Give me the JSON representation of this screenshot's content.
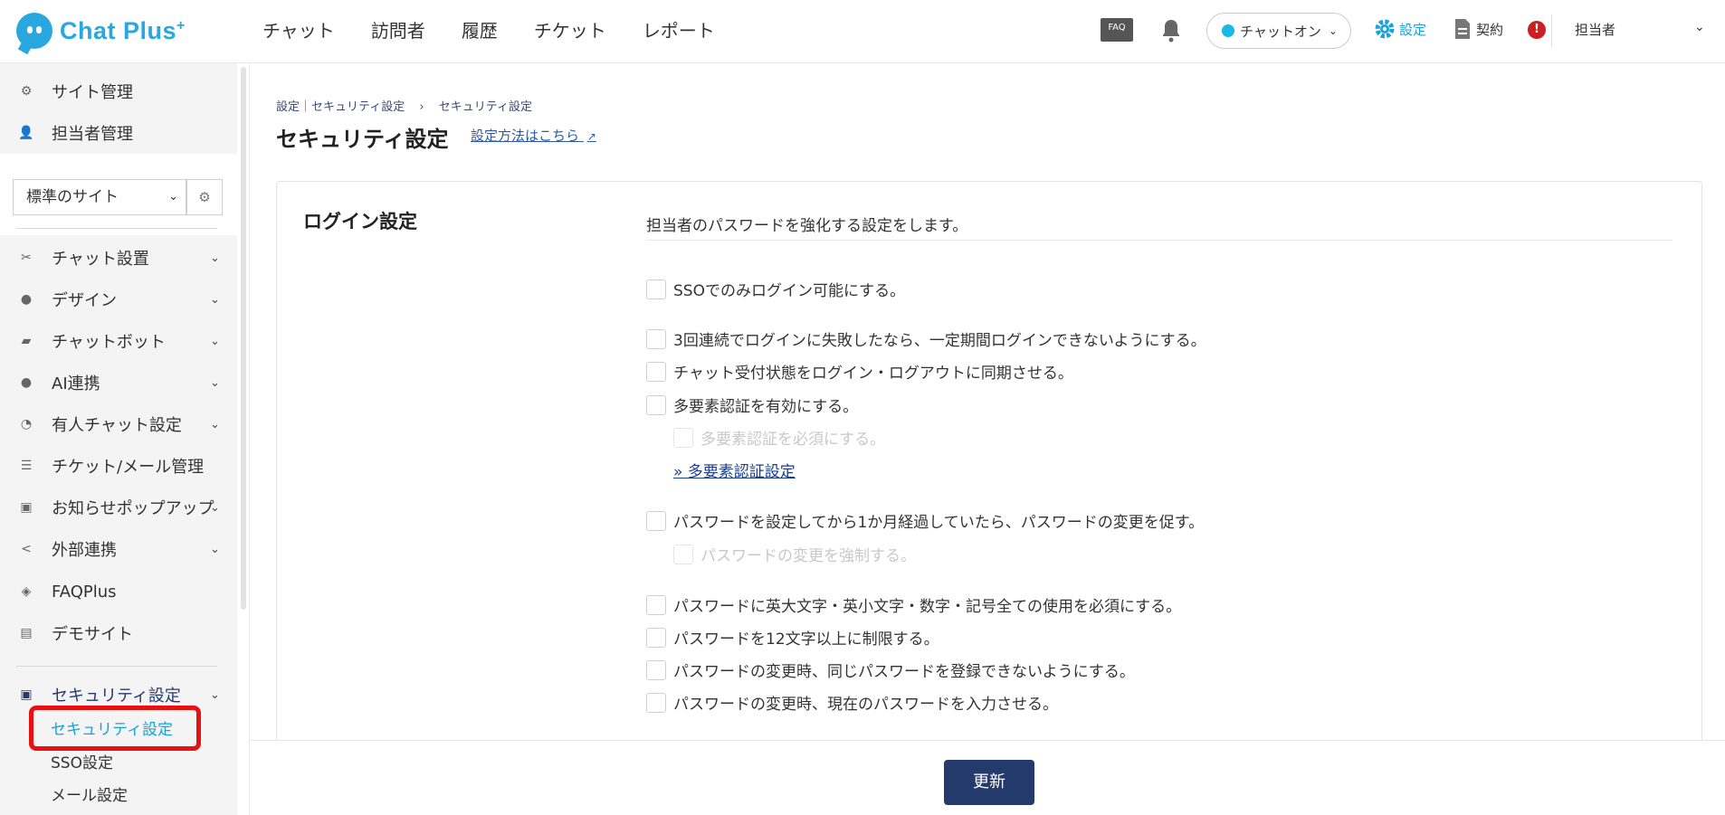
{
  "app": {
    "name": "Chat Plus",
    "name_sup": "+"
  },
  "topnav": [
    "チャット",
    "訪問者",
    "履歴",
    "チケット",
    "レポート"
  ],
  "header": {
    "faq_label": "FAQ",
    "chat_status": "チャットオン",
    "settings_label": "設定",
    "contract_label": "契約",
    "alert_label": "!",
    "user_label": "担当者"
  },
  "sidebar": {
    "top_items": [
      {
        "label": "サイト管理",
        "icon": "gear-sites-icon"
      },
      {
        "label": "担当者管理",
        "icon": "user-gear-icon"
      }
    ],
    "site_select": "標準のサイト",
    "items": [
      {
        "label": "チャット設置",
        "icon": "tools-icon",
        "has_chevron": true
      },
      {
        "label": "デザイン",
        "icon": "palette-icon",
        "has_chevron": true
      },
      {
        "label": "チャットボット",
        "icon": "chat-bubble-icon",
        "has_chevron": true
      },
      {
        "label": "AI連携",
        "icon": "bulb-icon",
        "has_chevron": true
      },
      {
        "label": "有人チャット設定",
        "icon": "headset-icon",
        "has_chevron": true
      },
      {
        "label": "チケット/メール管理",
        "icon": "list-icon",
        "has_chevron": false
      },
      {
        "label": "お知らせポップアップ",
        "icon": "popup-icon",
        "has_chevron": true
      },
      {
        "label": "外部連携",
        "icon": "share-icon",
        "has_chevron": true
      },
      {
        "label": "FAQPlus",
        "icon": "faq-plus-icon",
        "has_chevron": false
      },
      {
        "label": "デモサイト",
        "icon": "browser-icon",
        "has_chevron": false
      }
    ],
    "security": {
      "label": "セキュリティ設定",
      "subitems": [
        "セキュリティ設定",
        "SSO設定",
        "メール設定"
      ]
    }
  },
  "breadcrumb": {
    "part1": "設定｜セキュリティ設定",
    "sep": "›",
    "part2": "セキュリティ設定"
  },
  "page": {
    "title": "セキュリティ設定",
    "howto_link": "設定方法はこちら"
  },
  "login_section": {
    "title": "ログイン設定",
    "description": "担当者のパスワードを強化する設定をします。",
    "options": [
      {
        "label": "SSOでのみログイン可能にする。",
        "disabled": false
      },
      {
        "label": "3回連続でログインに失敗したなら、一定期間ログインできないようにする。",
        "disabled": false
      },
      {
        "label": "チャット受付状態をログイン・ログアウトに同期させる。",
        "disabled": false
      },
      {
        "label": "多要素認証を有効にする。",
        "disabled": false
      },
      {
        "label": "多要素認証を必須にする。",
        "disabled": true
      },
      {
        "label": "パスワードを設定してから1か月経過していたら、パスワードの変更を促す。",
        "disabled": false
      },
      {
        "label": "パスワードの変更を強制する。",
        "disabled": true
      },
      {
        "label": "パスワードに英大文字・英小文字・数字・記号全ての使用を必須にする。",
        "disabled": false
      },
      {
        "label": "パスワードを12文字以上に制限する。",
        "disabled": false
      },
      {
        "label": "パスワードの変更時、同じパスワードを登録できないようにする。",
        "disabled": false
      },
      {
        "label": "パスワードの変更時、現在のパスワードを入力させる。",
        "disabled": false
      }
    ],
    "mfa_link": "» 多要素認証設定"
  },
  "footer": {
    "update_button": "更新"
  },
  "colors": {
    "brand": "#29a8e0",
    "primary_button": "#253a6c",
    "highlight": "#e81010",
    "active_link": "#16a3db"
  }
}
